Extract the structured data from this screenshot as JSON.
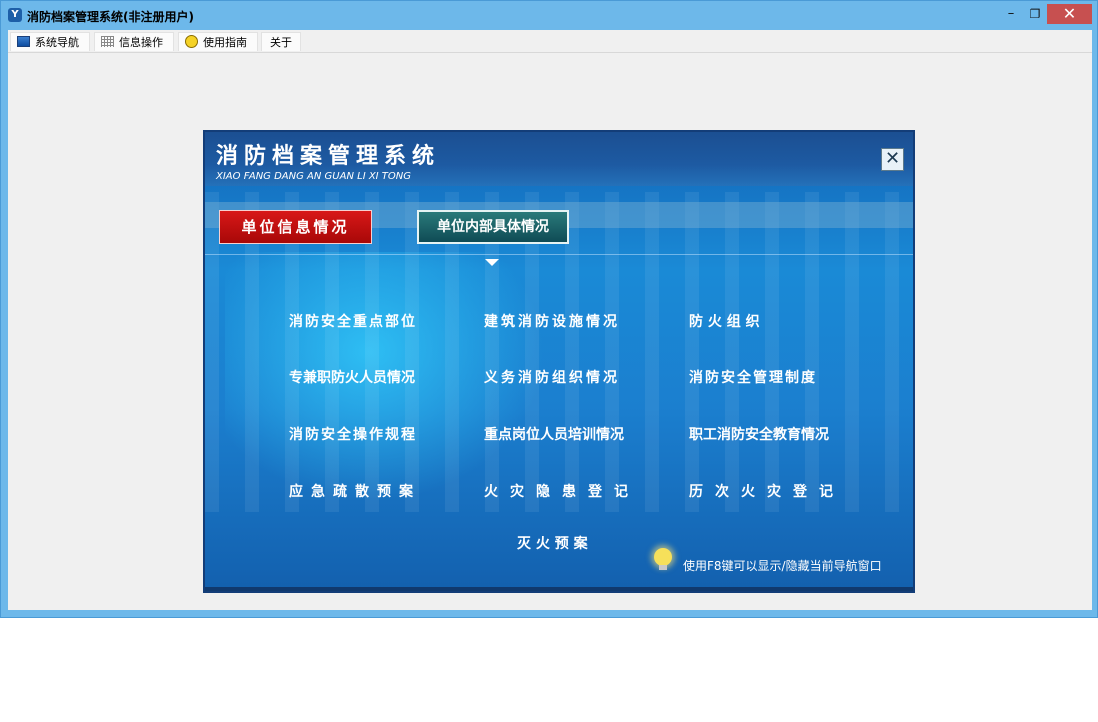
{
  "window": {
    "title": "消防档案管理系统(非注册用户)",
    "app_icon": "app-logo-icon",
    "controls": {
      "minimize": "–",
      "maximize": "❐",
      "close": "✕"
    }
  },
  "menubar": {
    "items": [
      {
        "label": "系统导航",
        "icon": "monitor-icon"
      },
      {
        "label": "信息操作",
        "icon": "grid-icon"
      },
      {
        "label": "使用指南",
        "icon": "lightbulb-icon"
      },
      {
        "label": "关于"
      }
    ]
  },
  "panel": {
    "title": "消防档案管理系统",
    "subtitle": "XIAO FANG DANG AN GUAN LI XI TONG",
    "close_glyph": "✕",
    "tabs": [
      {
        "label": "单位信息情况",
        "active": false
      },
      {
        "label": "单位内部具体情况",
        "active": true
      }
    ],
    "links": [
      "消防安全重点部位",
      "建筑消防设施情况",
      "防 火 组 织",
      "专兼职防火人员情况",
      "义务消防组织情况",
      "消防安全管理制度",
      "消防安全操作规程",
      "重点岗位人员培训情况",
      "职工消防安全教育情况",
      "应急疏散预案",
      "火灾隐患登记",
      "历次火灾登记",
      "灭 火 预 案"
    ],
    "hint": "使用F8键可以显示/隐藏当前导航窗口"
  },
  "colors": {
    "window_frame": "#6db8ea",
    "client_bg": "#f0f0f0",
    "panel_blue": "#1a8ad6",
    "tab_red": "#c81010",
    "tab_teal": "#1f6a6e",
    "close_red": "#c75050"
  }
}
